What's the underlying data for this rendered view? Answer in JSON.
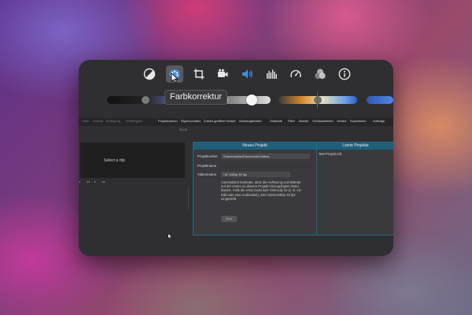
{
  "toolbar": {
    "icons": [
      "contrast-icon",
      "color-palette-icon",
      "crop-icon",
      "video-camera-icon",
      "speaker-icon",
      "equalizer-icon",
      "speedometer-icon",
      "color-circles-icon",
      "info-icon"
    ],
    "active": "color-palette-icon",
    "tooltip": "Farbkorrektur"
  },
  "menubar": {
    "items": [
      {
        "label": "Datei",
        "dim": true
      },
      {
        "label": "Ansicht",
        "dim": true
      },
      {
        "label": "Einfügung",
        "dim": true
      },
      {
        "label": "Wiedergabe",
        "dim": true
      },
      {
        "label": "Projektnamen",
        "dim": false
      },
      {
        "label": "Eigenschaften",
        "dim": false
      },
      {
        "label": "Zuletzt geöffnet",
        "dim": false
      },
      {
        "label": "Verlauf",
        "dim": false
      },
      {
        "label": "Wiedergabeliste",
        "dim": false
      },
      {
        "label": "Zeitleiste",
        "dim": false
      },
      {
        "label": "Filter",
        "dim": false
      },
      {
        "label": "Marker",
        "dim": false
      },
      {
        "label": "Schlüsselbilder",
        "dim": false
      },
      {
        "label": "Verlauf",
        "dim": false
      },
      {
        "label": "Exportieren",
        "dim": false
      },
      {
        "label": "Aufträge",
        "dim": false
      }
    ],
    "counter": "00:00"
  },
  "source_panel": {
    "placeholder": "Select a clip"
  },
  "new_project": {
    "title": "Neues Projekt",
    "folder_label": "Projektordner",
    "folder_value": "/Users/martin/Documents/Videos",
    "name_label": "Projektname",
    "name_value": "",
    "mode_label": "Videomodus",
    "mode_value": "HD 1080p 30 fps",
    "description": "Automatisch bedeutet, dass die Auflösung und Bildrate auf der ersten zu diesem Projekt hinzugefügten Datei basiert. Falls die erste Datei kein Videoclip ist (z. B. ein Bild oder eine Audiodatei), wird 1920x1080p 25 fps eingestellt.",
    "start_button": "Start"
  },
  "recent_projects": {
    "title": "Letzte Projekte",
    "items": [
      "Test-Projekt.mlt"
    ]
  },
  "colors": {
    "accent": "#1f5f7a",
    "window_bg": "#2f2f31",
    "speaker_blue": "#3d8ee6"
  }
}
